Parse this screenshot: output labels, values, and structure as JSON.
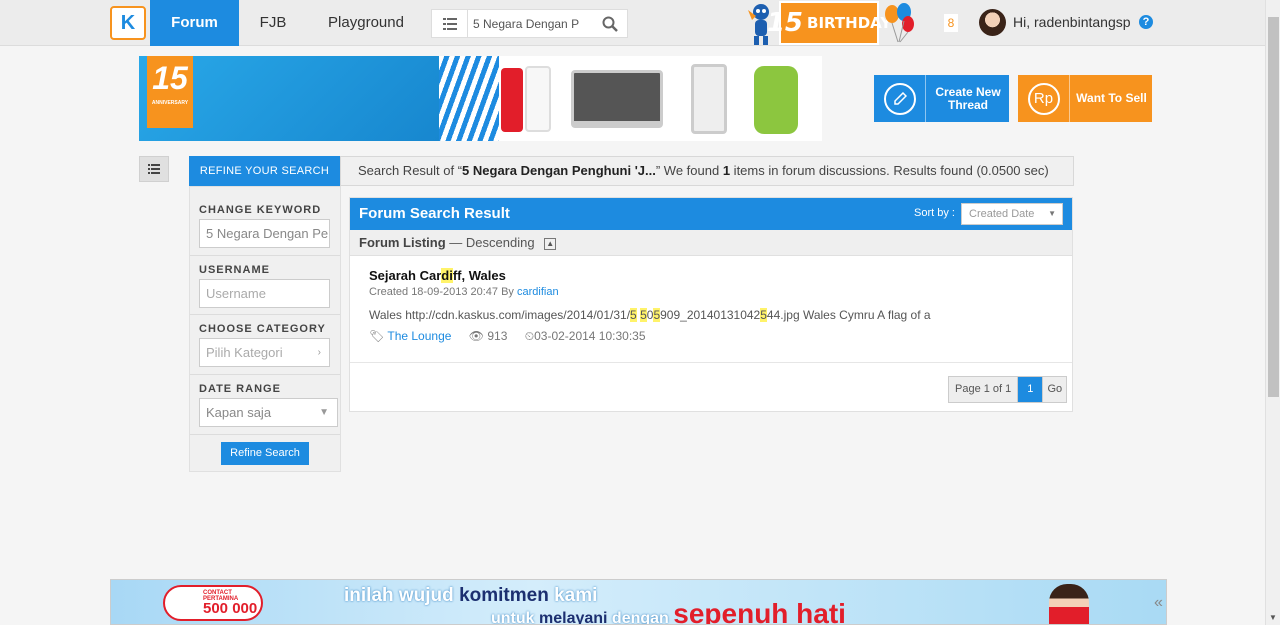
{
  "nav": {
    "logo_letter": "K",
    "tabs": [
      {
        "label": "Forum"
      },
      {
        "label": "FJB"
      },
      {
        "label": "Playground"
      }
    ],
    "search_value": "5 Negara Dengan P",
    "birthday_label": "BIRTHDAY",
    "birthday_number": "15",
    "notification_count": "8",
    "greeting": "Hi, radenbintangsp",
    "help": "?"
  },
  "banner": {
    "anniversary_number": "15",
    "anniversary_label": "ANNIVERSARY"
  },
  "actions": {
    "create_thread": "Create New Thread",
    "sell": "Want To Sell",
    "sell_icon_text": "Rp"
  },
  "refine": {
    "tab_label": "REFINE YOUR SEARCH",
    "summary_prefix": "Search Result of “",
    "summary_query": "5 Negara Dengan Penghuni 'J...",
    "summary_mid": "” We found ",
    "summary_count": "1",
    "summary_suffix": " items in forum discussions. Results found (0.0500 sec)"
  },
  "sidebar": {
    "keyword_label": "CHANGE KEYWORD",
    "keyword_value": "5 Negara Dengan Pe",
    "username_label": "USERNAME",
    "username_placeholder": "Username",
    "category_label": "CHOOSE CATEGORY",
    "category_placeholder": "Pilih Kategori",
    "date_label": "DATE RANGE",
    "date_value": "Kapan saja",
    "button": "Refine Search"
  },
  "results": {
    "title": "Forum Search Result",
    "sort_label": "Sort by :",
    "sort_value": "Created Date",
    "listing_label": "Forum Listing",
    "listing_order": " — Descending",
    "thread": {
      "title_pre": "Sejarah Car",
      "title_hl": "di",
      "title_post": "ff, Wales",
      "created": "Created 18-09-2013 20:47 By ",
      "author": "cardifian",
      "snippet_pre": "Wales http://cdn.kaskus.com/images/2014/01/31/",
      "snippet_hl1": "5",
      "snippet_sp": " ",
      "snippet_hl2": "5",
      "snippet_mid1": "0",
      "snippet_hl3": "5",
      "snippet_mid2": "909_20140131042",
      "snippet_hl4": "5",
      "snippet_post": "44.jpg Wales Cymru A flag of a",
      "category": "The Lounge",
      "views": "913",
      "last_post": "03-02-2014 10:30:35"
    },
    "pager_info": "Page 1 of 1",
    "pager_current": "1",
    "pager_go": "Go"
  },
  "ad": {
    "badge_top": "CONTACT PERTAMINA",
    "badge_number": "500 000",
    "line1_a": "inilah wujud ",
    "line1_b": "komitmen",
    "line1_c": " kami",
    "line2_a": "untuk ",
    "line2_b": "melayani",
    "line2_c": " dengan ",
    "line2_d": "sepenuh hati"
  }
}
